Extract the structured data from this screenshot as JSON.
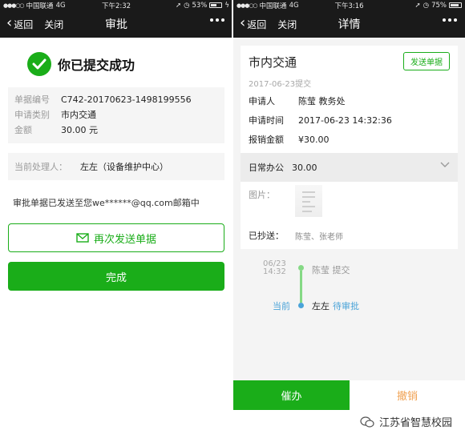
{
  "left": {
    "status": {
      "carrier": "中国联通",
      "network": "4G",
      "time": "下午2:32",
      "battery": "53%",
      "battery_level": 0.53
    },
    "nav": {
      "back": "返回",
      "close": "关闭",
      "title": "审批"
    },
    "success_text": "你已提交成功",
    "info": {
      "rows": [
        {
          "label": "单据编号",
          "value": "C742-20170623-1498199556"
        },
        {
          "label": "申请类别",
          "value": "市内交通"
        },
        {
          "label": "金额",
          "value": "30.00 元"
        }
      ]
    },
    "handler": {
      "label": "当前处理人：",
      "value": "左左（设备维护中心）"
    },
    "sent_message": "审批单据已发送至您we******@qq.com邮箱中",
    "resend_label": "再次发送单据",
    "done_label": "完成"
  },
  "right": {
    "status": {
      "carrier": "中国联通",
      "network": "4G",
      "time": "下午3:16",
      "battery": "75%",
      "battery_level": 0.75
    },
    "nav": {
      "back": "返回",
      "close": "关闭",
      "title": "详情"
    },
    "detail": {
      "title": "市内交通",
      "date": "2017-06-23提交",
      "send_button": "发送单据",
      "rows": [
        {
          "label": "申请人",
          "value": "陈莹 教务处"
        },
        {
          "label": "申请时间",
          "value": "2017-06-23 14:32:36"
        },
        {
          "label": "报销金额",
          "value": "¥30.00"
        }
      ],
      "category": {
        "label": "日常办公",
        "value": "30.00"
      },
      "image_label": "图片：",
      "cc": {
        "label": "已抄送：",
        "value": "陈莹、张老师"
      }
    },
    "timeline": {
      "date_line1": "06/23",
      "date_line2": "14:32",
      "first": "陈莹 提交",
      "current_label": "当前",
      "second_name": "左左",
      "second_status": "待审批"
    },
    "bottom": {
      "urge": "催办",
      "revoke": "撤销"
    }
  },
  "watermark": "江苏省智慧校园",
  "colors": {
    "accent_green": "#1aad19",
    "timeline_blue": "#4aa3d8",
    "revoke_orange": "#f0a050"
  }
}
